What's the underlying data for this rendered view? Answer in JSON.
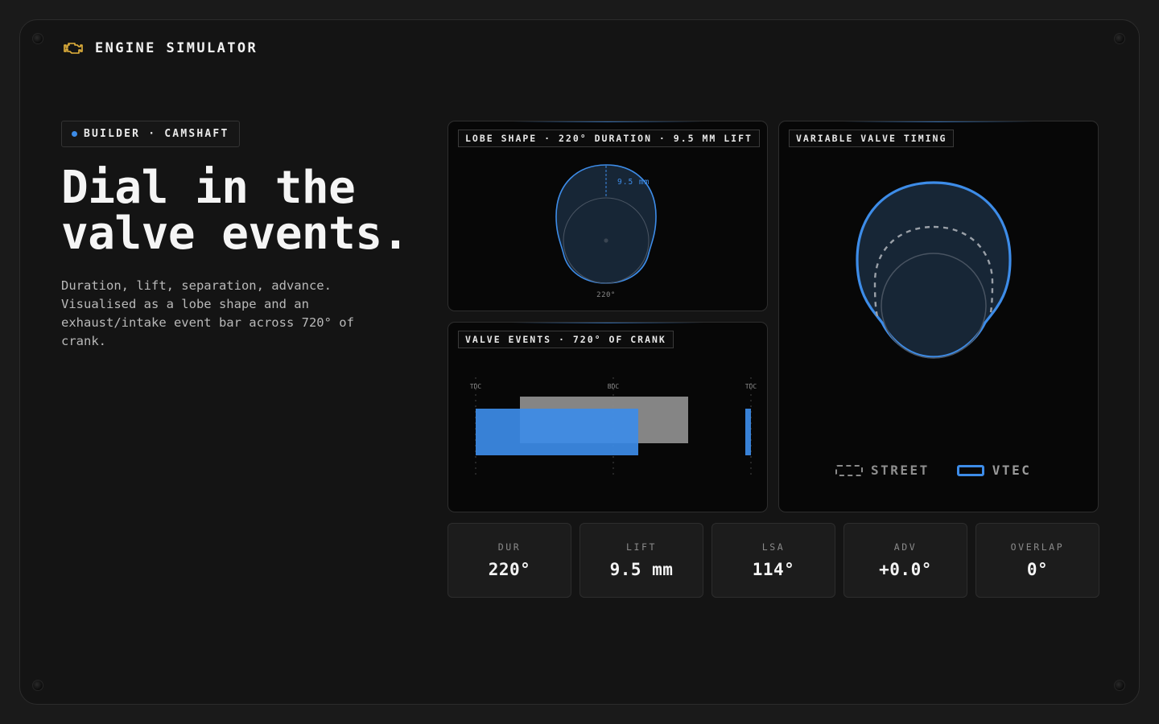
{
  "app": {
    "title": "ENGINE SIMULATOR",
    "icon": "engine-check-icon",
    "icon_color": "#e7b43c"
  },
  "chip": {
    "label": "BUILDER · CAMSHAFT",
    "dot_color": "#3d8ce8"
  },
  "hero": {
    "line1": "Dial in the",
    "line2": "valve events.",
    "lead": "Duration, lift, separation, advance. Visualised as a lobe shape and an exhaust/intake event bar across 720° of crank."
  },
  "lobe_panel": {
    "tag": "LOBE SHAPE · 220° DURATION · 9.5 MM LIFT",
    "lift_label": "9.5 mm",
    "duration_label": "220°"
  },
  "valve_panel": {
    "tag": "VALVE EVENTS · 720° OF CRANK",
    "markers": [
      "TDC",
      "BDC",
      "TDC"
    ]
  },
  "vvt_panel": {
    "tag": "VARIABLE VALVE TIMING",
    "legend": [
      {
        "label": "STREET",
        "style": "dashed"
      },
      {
        "label": "VTEC",
        "style": "solid"
      }
    ]
  },
  "stats": [
    {
      "label": "DUR",
      "value": "220°"
    },
    {
      "label": "LIFT",
      "value": "9.5 mm"
    },
    {
      "label": "LSA",
      "value": "114°"
    },
    {
      "label": "ADV",
      "value": "+0.0°"
    },
    {
      "label": "OVERLAP",
      "value": "0°"
    }
  ],
  "colors": {
    "accent": "#3d8ce8",
    "exhaust": "#8a8a8a",
    "background": "#141414"
  }
}
